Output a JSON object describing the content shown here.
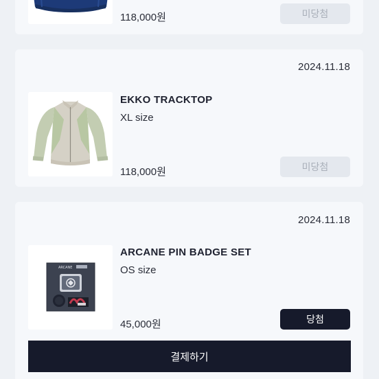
{
  "orders": [
    {
      "date": "",
      "product": "",
      "size": "",
      "price": "118,000원",
      "status_label": "미당첨",
      "status": "lost",
      "image": "navy-jacket-thumbnail"
    },
    {
      "date": "2024.11.18",
      "product": "EKKO TRACKTOP",
      "size": "XL size",
      "price": "118,000원",
      "status_label": "미당첨",
      "status": "lost",
      "image": "tracktop-jacket-thumbnail"
    },
    {
      "date": "2024.11.18",
      "product": "ARCANE PIN BADGE SET",
      "size": "OS size",
      "price": "45,000원",
      "status_label": "당첨",
      "status": "won",
      "image": "pin-badge-set-thumbnail",
      "badge_set_text": "ARCANE"
    }
  ],
  "pay_button_label": "결제하기",
  "colors": {
    "background": "#eef1f5",
    "card": "#f6f8fb",
    "primary_dark": "#161a2b",
    "disabled_button": "#e4e8ee",
    "disabled_text": "#a9afb9"
  }
}
